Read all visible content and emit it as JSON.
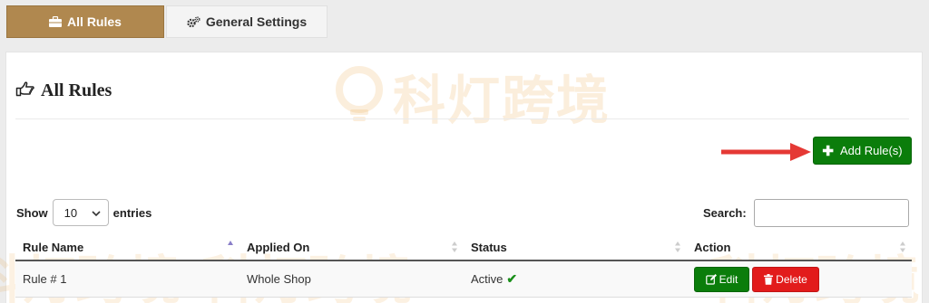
{
  "tabs": [
    {
      "label": "All Rules",
      "icon": "briefcase-icon",
      "active": true
    },
    {
      "label": "General Settings",
      "icon": "cogs-icon",
      "active": false
    }
  ],
  "panel": {
    "title": "All Rules",
    "title_icon": "hand-pointing-icon",
    "add_button_label": "Add Rule(s)",
    "watermark_text": "科灯跨境"
  },
  "length_control": {
    "prefix": "Show",
    "value": "10",
    "suffix": "entries"
  },
  "search": {
    "label": "Search:",
    "value": "",
    "placeholder": ""
  },
  "table": {
    "columns": [
      "Rule Name",
      "Applied On",
      "Status",
      "Action"
    ],
    "rows": [
      {
        "name": "Rule # 1",
        "applied_on": "Whole Shop",
        "status": "Active",
        "edit_label": "Edit",
        "delete_label": "Delete"
      }
    ]
  },
  "colors": {
    "tab_active": "#b0884f",
    "add_button": "#0b7d0b",
    "delete_button": "#e21b1b",
    "status_check": "#1a8f1a",
    "arrow": "#e53935"
  }
}
